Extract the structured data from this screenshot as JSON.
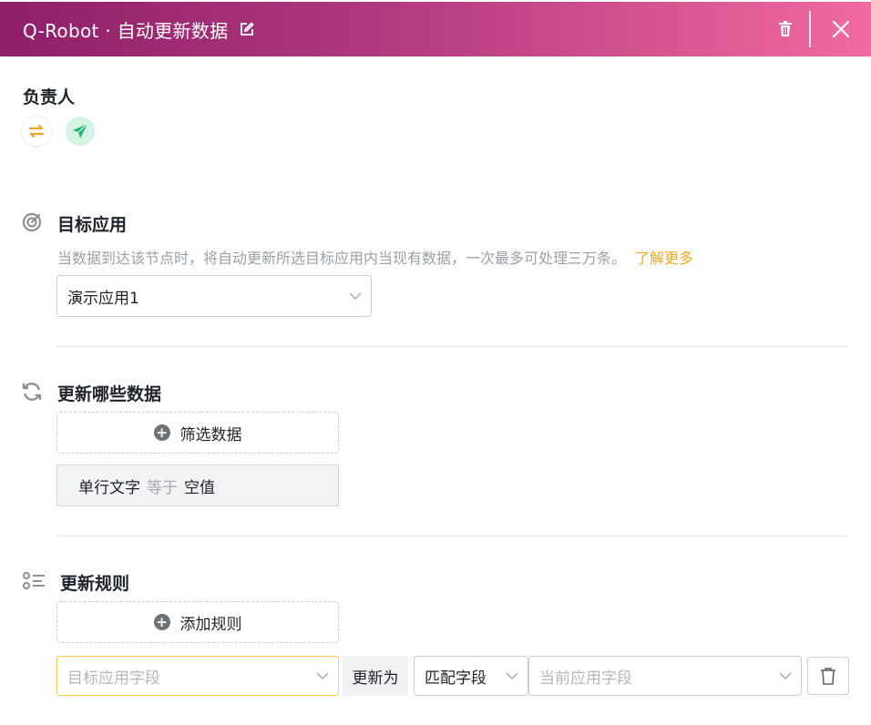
{
  "header": {
    "title": "Q-Robot · 自动更新数据",
    "edit_icon": "edit-icon",
    "delete_icon": "trash-icon",
    "close_icon": "close-icon",
    "gradient_from": "#8e1f6a",
    "gradient_to": "#f26a9f"
  },
  "owner": {
    "label": "负责人",
    "avatars": [
      "swap-arrows-icon",
      "send-icon"
    ]
  },
  "target_app": {
    "title": "目标应用",
    "icon": "target-icon",
    "description": "当数据到达该节点时，将自动更新所选目标应用内当现有数据，一次最多可处理三万条。",
    "learn_more": "了解更多",
    "selected_app": "演示应用1"
  },
  "which_data": {
    "title": "更新哪些数据",
    "icon": "refresh-icon",
    "filter_button": "筛选数据",
    "condition": {
      "field": "单行文字",
      "operator": "等于",
      "value": "空值"
    }
  },
  "rules": {
    "title": "更新规则",
    "icon": "list-icon",
    "add_button": "添加规则",
    "target_field_placeholder": "目标应用字段",
    "update_as": "更新为",
    "match_type": "匹配字段",
    "source_field_placeholder": "当前应用字段",
    "delete_icon": "trash-icon"
  },
  "colors": {
    "accent_link": "#f0a820",
    "focus_border": "#f5cc4e"
  }
}
